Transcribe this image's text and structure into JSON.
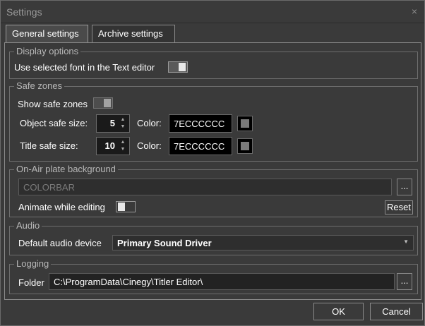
{
  "window": {
    "title": "Settings",
    "close_glyph": "×"
  },
  "tabs": [
    {
      "label": "General settings",
      "active": true
    },
    {
      "label": "Archive  settings",
      "active": false
    }
  ],
  "display_options": {
    "group_label": "Display options",
    "use_font_label": "Use selected font in the Text editor",
    "use_font_on": true
  },
  "safe_zones": {
    "group_label": "Safe zones",
    "show_label": "Show safe zones",
    "show_on": true,
    "object_label": "Object safe size:",
    "object_value": "5",
    "object_color_label": "Color:",
    "object_color_value": "7ECCCCCC",
    "title_label": "Title safe size:",
    "title_value": "10",
    "title_color_label": "Color:",
    "title_color_value": "7ECCCCCC"
  },
  "onair": {
    "group_label": "On-Air plate background",
    "background_value": "COLORBAR",
    "browse_label": "...",
    "animate_label": "Animate while editing",
    "animate_on": false,
    "reset_label": "Reset"
  },
  "audio": {
    "group_label": "Audio",
    "device_label": "Default audio device",
    "device_value": "Primary Sound Driver"
  },
  "logging": {
    "group_label": "Logging",
    "folder_label": "Folder",
    "folder_value": "C:\\ProgramData\\Cinegy\\Titler Editor\\",
    "browse_label": "..."
  },
  "footer": {
    "ok_label": "OK",
    "cancel_label": "Cancel"
  },
  "colors": {
    "background": "#3a3a3a",
    "border": "#6e6e6e",
    "swatch": "#7a7a7a"
  }
}
